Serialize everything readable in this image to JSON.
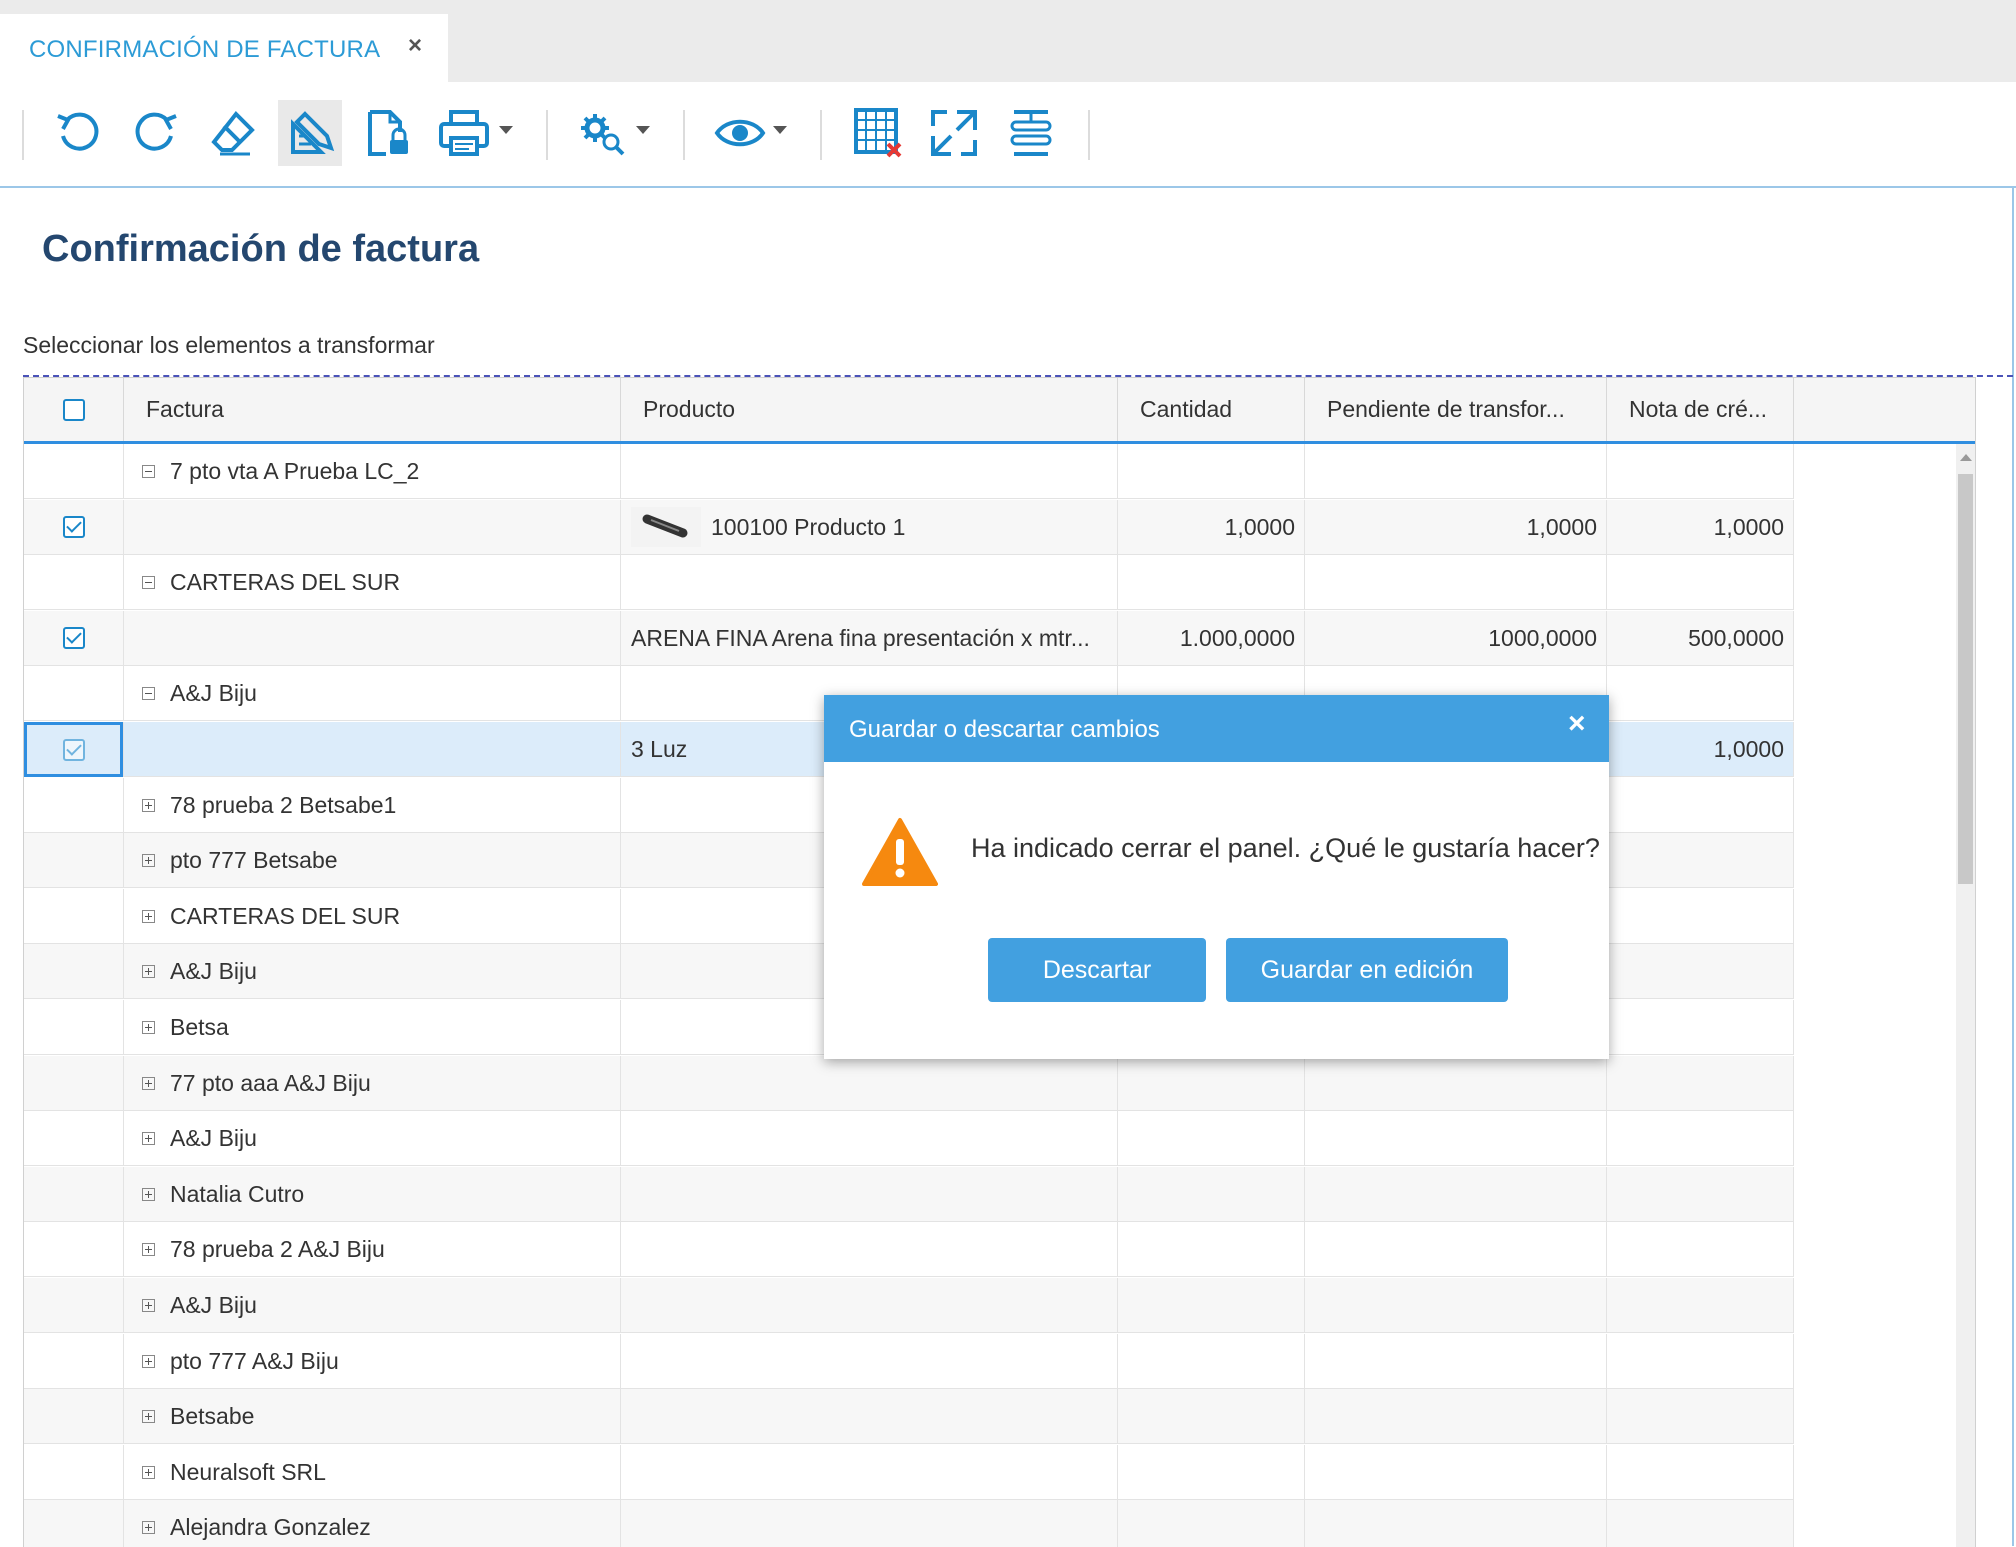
{
  "tab": {
    "title": "CONFIRMACIÓN DE FACTURA",
    "close": "×"
  },
  "page": {
    "title": "Confirmación de factura",
    "subtitle": "Seleccionar los elementos a transformar"
  },
  "accent_color": "#42a0e0",
  "toolbar_icons": [
    "undo-icon",
    "redo-icon",
    "eraser-icon",
    "edit-ruler-icon",
    "document-lock-icon",
    "print-icon",
    "settings-search-icon",
    "view-eye-icon",
    "grid-delete-icon",
    "expand-icon",
    "collapse-rows-icon"
  ],
  "grid": {
    "columns": [
      "Factura",
      "Producto",
      "Cantidad",
      "Pendiente de transfor...",
      "Nota de cré..."
    ],
    "rows": [
      {
        "type": "group",
        "expanded": true,
        "factura": "7 pto vta A Prueba LC_2"
      },
      {
        "type": "item",
        "checked": true,
        "producto": "100100 Producto 1",
        "has_image": true,
        "cantidad": "1,0000",
        "pendiente": "1,0000",
        "nota": "1,0000"
      },
      {
        "type": "group",
        "expanded": true,
        "factura": "CARTERAS DEL SUR"
      },
      {
        "type": "item",
        "checked": true,
        "producto": "ARENA FINA Arena fina presentación x mtr...",
        "cantidad": "1.000,0000",
        "pendiente": "1000,0000",
        "nota": "500,0000"
      },
      {
        "type": "group",
        "expanded": true,
        "factura": "A&J Biju"
      },
      {
        "type": "item",
        "checked": true,
        "selected": true,
        "producto": "3 Luz",
        "cantidad": "",
        "pendiente": "",
        "nota": "1,0000"
      },
      {
        "type": "group",
        "expanded": false,
        "factura": "78 prueba 2 Betsabe1"
      },
      {
        "type": "group",
        "expanded": false,
        "factura": "pto 777 Betsabe"
      },
      {
        "type": "group",
        "expanded": false,
        "factura": "CARTERAS DEL SUR"
      },
      {
        "type": "group",
        "expanded": false,
        "factura": "A&J Biju"
      },
      {
        "type": "group",
        "expanded": false,
        "factura": "Betsa"
      },
      {
        "type": "group",
        "expanded": false,
        "factura": "77 pto aaa A&J Biju"
      },
      {
        "type": "group",
        "expanded": false,
        "factura": "A&J Biju"
      },
      {
        "type": "group",
        "expanded": false,
        "factura": "Natalia Cutro"
      },
      {
        "type": "group",
        "expanded": false,
        "factura": "78 prueba 2 A&J Biju"
      },
      {
        "type": "group",
        "expanded": false,
        "factura": "A&J Biju"
      },
      {
        "type": "group",
        "expanded": false,
        "factura": "pto 777 A&J Biju"
      },
      {
        "type": "group",
        "expanded": false,
        "factura": "Betsabe"
      },
      {
        "type": "group",
        "expanded": false,
        "factura": "Neuralsoft SRL"
      },
      {
        "type": "group",
        "expanded": false,
        "factura": "Alejandra Gonzalez"
      }
    ]
  },
  "dialog": {
    "title": "Guardar o descartar cambios",
    "close": "×",
    "message": "Ha indicado cerrar el panel. ¿Qué le gustaría hacer?",
    "discard_label": "Descartar",
    "save_label": "Guardar en edición"
  }
}
